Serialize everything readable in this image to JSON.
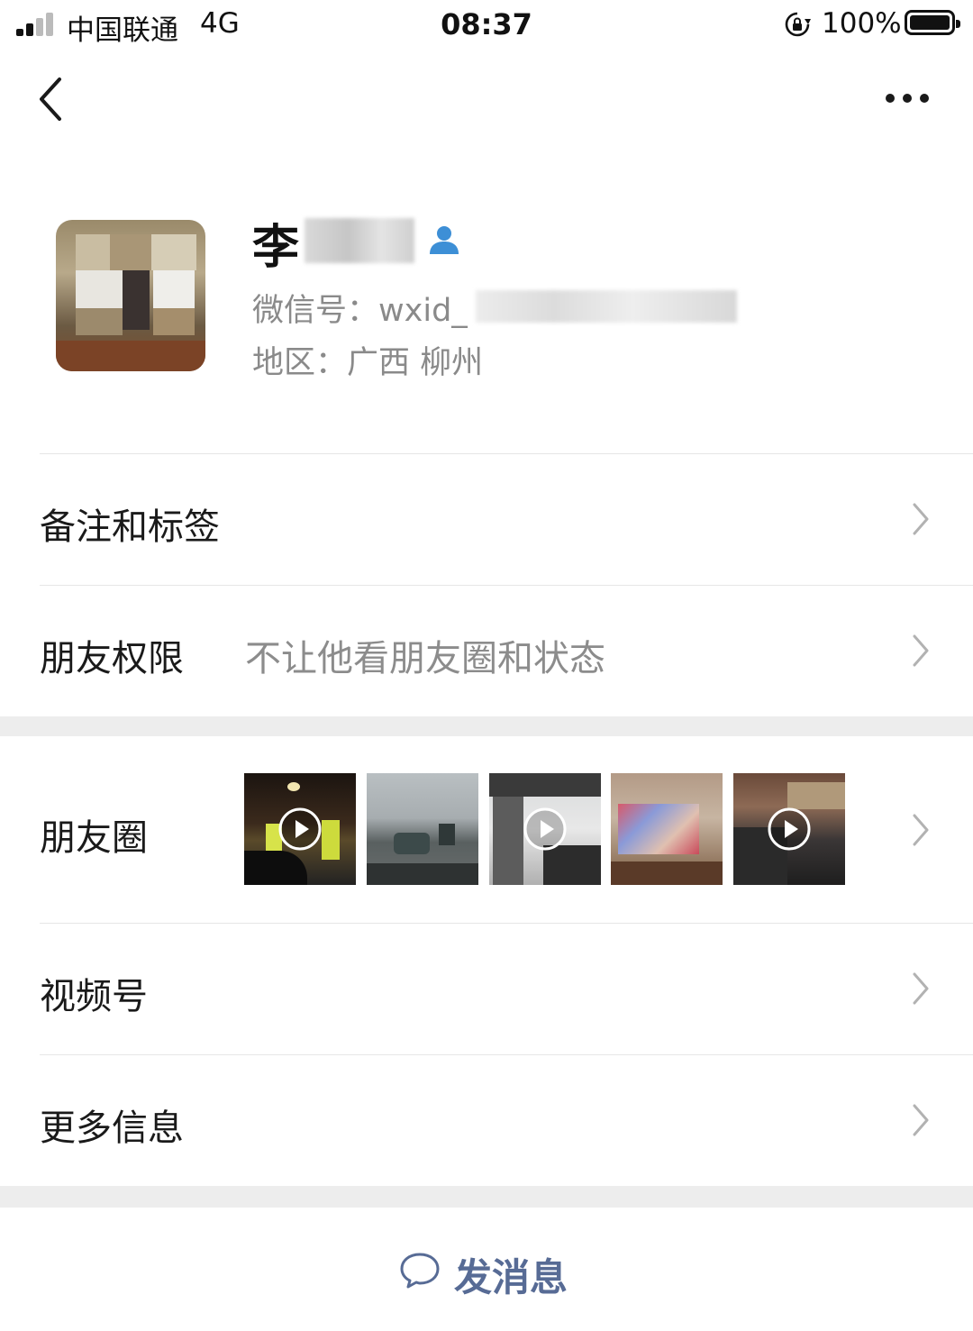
{
  "status_bar": {
    "carrier": "中国联通",
    "network": "4G",
    "time": "08:37",
    "battery": "100%"
  },
  "nav": {
    "back_icon": "chevron-left-icon",
    "more_icon": "ellipsis-icon"
  },
  "profile": {
    "name": "李",
    "wxid_label": "微信号：wxid_",
    "region": "地区：广西 柳州"
  },
  "rows": {
    "remark": {
      "label": "备注和标签"
    },
    "permission": {
      "label": "朋友权限",
      "value": "不让他看朋友圈和状态"
    },
    "moments": {
      "label": "朋友圈"
    },
    "channels": {
      "label": "视频号"
    },
    "more_info": {
      "label": "更多信息"
    }
  },
  "send_message": {
    "label": "发消息"
  },
  "colors": {
    "link_blue": "#576b95",
    "contact_icon_blue": "#3d8fd6",
    "gap_gray": "#ededed"
  }
}
